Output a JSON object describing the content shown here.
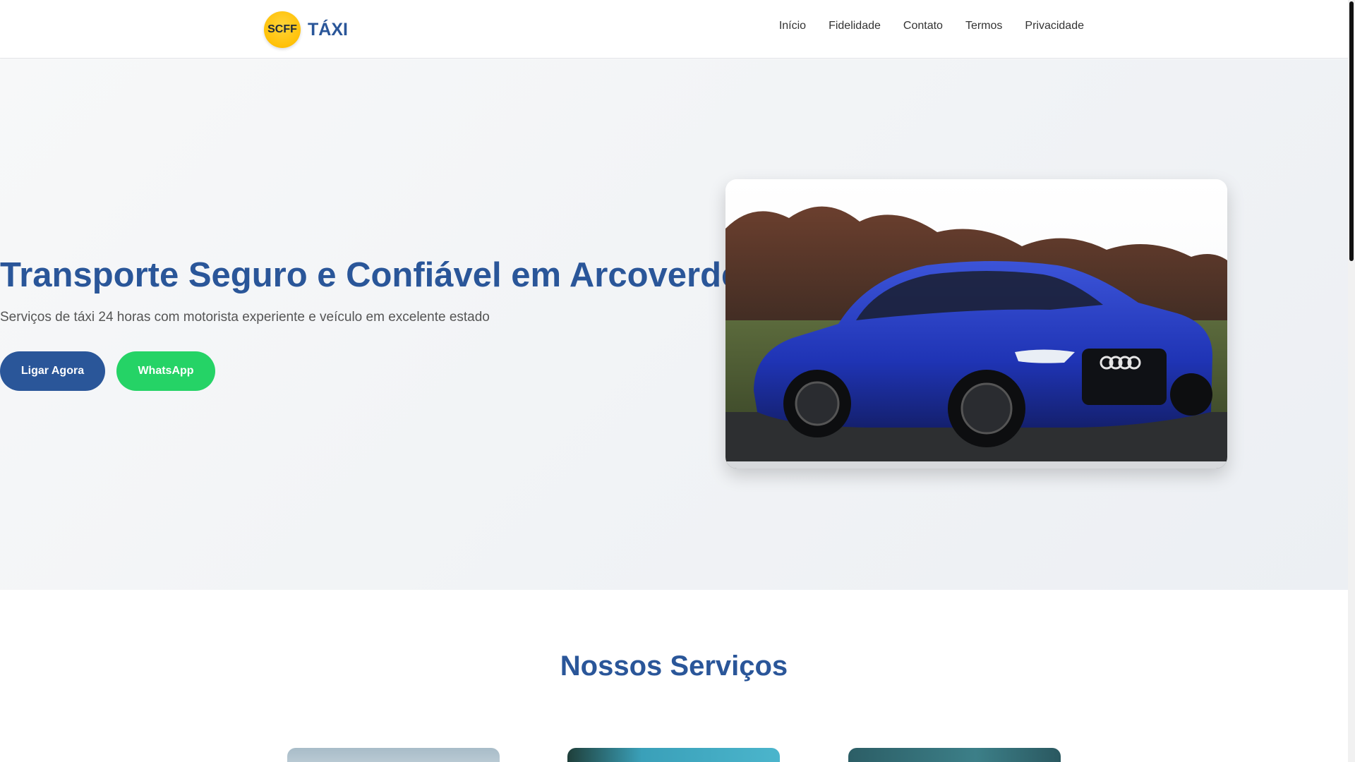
{
  "brand": {
    "badge": "SCFF",
    "name": "TÁXI"
  },
  "nav": [
    {
      "label": "Início"
    },
    {
      "label": "Fidelidade"
    },
    {
      "label": "Contato"
    },
    {
      "label": "Termos"
    },
    {
      "label": "Privacidade"
    }
  ],
  "hero": {
    "title": "Transporte Seguro e Confiável em Arcoverde",
    "subtitle": "Serviços de táxi 24 horas com motorista experiente e veículo em excelente estado",
    "call_label": "Ligar Agora",
    "whatsapp_label": "WhatsApp",
    "image_icon": "car-photo"
  },
  "services": {
    "title": "Nossos Serviços"
  },
  "colors": {
    "primary": "#2a5699",
    "whatsapp": "#25d366",
    "logo_yellow": "#ffc107"
  }
}
